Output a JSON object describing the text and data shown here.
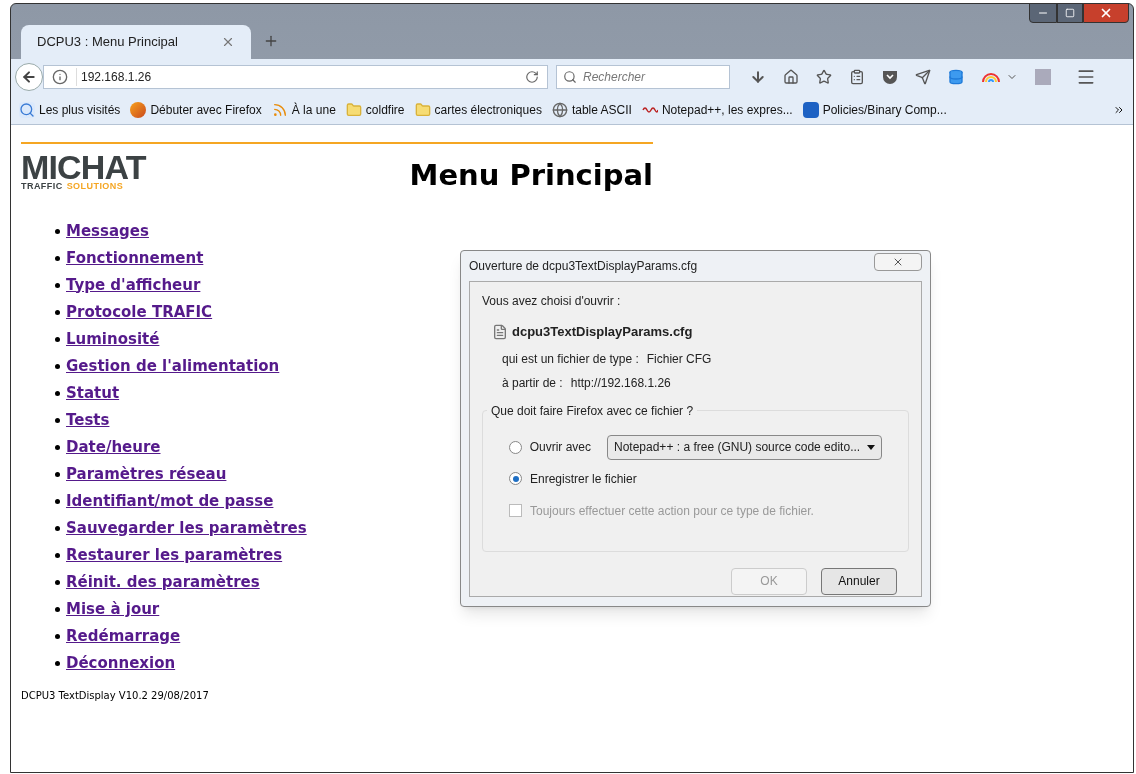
{
  "tabs": [
    {
      "label": "DCPU3 : Menu Principal",
      "selected": true
    }
  ],
  "toolbar": {
    "url": "192.168.1.26",
    "search_placeholder": "Rechercher"
  },
  "bookmarks": [
    {
      "kind": "history",
      "label": "Les plus visités"
    },
    {
      "kind": "firefox",
      "label": "Débuter avec Firefox"
    },
    {
      "kind": "rss",
      "label": "À la une"
    },
    {
      "kind": "folder",
      "label": "coldfire"
    },
    {
      "kind": "folder",
      "label": "cartes électroniques"
    },
    {
      "kind": "globe",
      "label": "table ASCII"
    },
    {
      "kind": "notepad",
      "label": "Notepad++, les expres..."
    },
    {
      "kind": "kde",
      "label": "Policies/Binary Comp..."
    }
  ],
  "page": {
    "logo": {
      "name": "MICHAT",
      "tagline_1": "TRAFFIC",
      "tagline_2": "SOLUTIONS"
    },
    "heading": "Menu Principal",
    "menu": [
      "Messages",
      "Fonctionnement",
      "Type d'afficheur",
      "Protocole TRAFIC",
      "Luminosité",
      "Gestion de l'alimentation",
      "Statut",
      "Tests",
      "Date/heure",
      "Paramètres réseau",
      "Identifiant/mot de passe",
      "Sauvegarder les paramètres",
      "Restaurer les paramètres",
      "Réinit. des paramètres",
      "Mise à jour",
      "Redémarrage",
      "Déconnexion"
    ],
    "footer": "DCPU3 TextDisplay V10.2 29/08/2017"
  },
  "dialog": {
    "title": "Ouverture de dcpu3TextDisplayParams.cfg",
    "intro": "Vous avez choisi d'ouvrir :",
    "file_name": "dcpu3TextDisplayParams.cfg",
    "type_label": "qui est un fichier de type :",
    "type_value": "Fichier CFG",
    "from_label": "à partir de :",
    "from_value": "http://192.168.1.26",
    "group_label": "Que doit faire Firefox avec ce fichier ?",
    "options": [
      {
        "label": "Ouvrir avec",
        "selected": false,
        "app": "Notepad++ : a free (GNU) source code edito..."
      },
      {
        "label": "Enregistrer le fichier",
        "selected": true
      }
    ],
    "always": {
      "label": "Toujours effectuer cette action pour ce type de fichier.",
      "checked": false,
      "disabled": true
    },
    "buttons": [
      {
        "label": "OK",
        "disabled": true
      },
      {
        "label": "Annuler",
        "disabled": false
      }
    ]
  }
}
